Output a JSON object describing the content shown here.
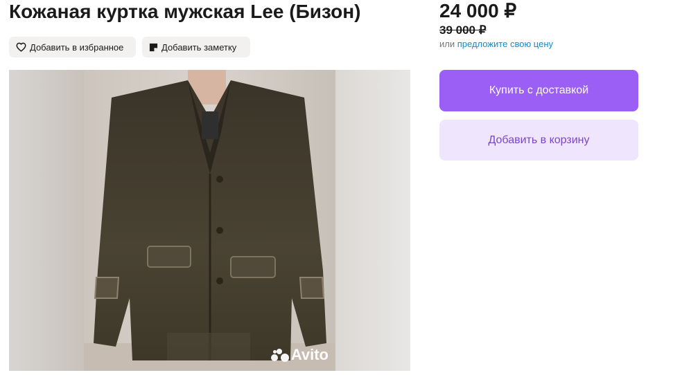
{
  "listing": {
    "title": "Кожаная куртка мужская Lee (Бизон)"
  },
  "actions": {
    "favorite_label": "Добавить в избранное",
    "note_label": "Добавить заметку"
  },
  "pricing": {
    "price": "24 000 ₽",
    "old_price": "39 000 ₽",
    "offer_prefix": "или",
    "offer_link": "предложите свою цену"
  },
  "buttons": {
    "buy_label": "Купить с доставкой",
    "cart_label": "Добавить в корзину"
  },
  "gallery": {
    "watermark": "Avito"
  },
  "colors": {
    "buy_button": "#9b5ff5",
    "cart_button": "#efe6fd",
    "link": "#0a8ed8"
  }
}
